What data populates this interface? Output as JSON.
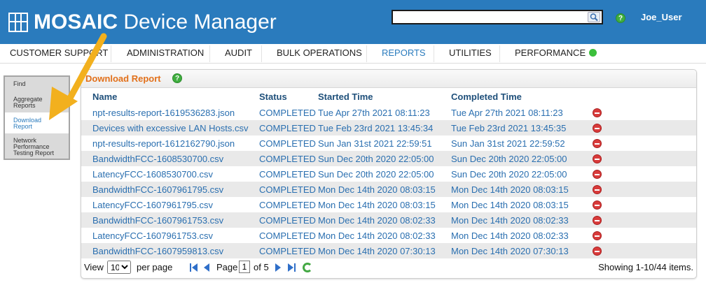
{
  "header": {
    "title_brand": "MOSAIC",
    "title_rest": " Device Manager",
    "search_placeholder": "",
    "help_glyph": "?",
    "user_name": "Joe_User",
    "icons": {
      "logo": "grid-logo-icon",
      "search": "magnifier-icon",
      "help": "help-icon"
    }
  },
  "nav": {
    "items": [
      {
        "label": "CUSTOMER SUPPORT",
        "active": false
      },
      {
        "label": "ADMINISTRATION",
        "active": false
      },
      {
        "label": "AUDIT",
        "active": false
      },
      {
        "label": "BULK OPERATIONS",
        "active": false
      },
      {
        "label": "REPORTS",
        "active": true
      },
      {
        "label": "UTILITIES",
        "active": false
      },
      {
        "label": "PERFORMANCE",
        "active": false
      }
    ],
    "performance_status_color": "#3bbf3b"
  },
  "sidebar": {
    "items": [
      {
        "label": "Find"
      },
      {
        "label": "Aggregate\nReports"
      },
      {
        "label": "Download\nReport",
        "selected": true
      },
      {
        "label": "Network\nPerformance\nTesting Report"
      }
    ]
  },
  "panel": {
    "title": "Download Report",
    "help_glyph": "?",
    "columns": [
      "Name",
      "Status",
      "Started Time",
      "Completed Time"
    ],
    "rows": [
      {
        "name": "npt-results-report-1619536283.json",
        "status": "COMPLETED",
        "started": "Tue Apr 27th 2021 08:11:23",
        "completed": "Tue Apr 27th 2021 08:11:23"
      },
      {
        "name": "Devices with excessive LAN Hosts.csv",
        "status": "COMPLETED",
        "started": "Tue Feb 23rd 2021 13:45:34",
        "completed": "Tue Feb 23rd 2021 13:45:35"
      },
      {
        "name": "npt-results-report-1612162790.json",
        "status": "COMPLETED",
        "started": "Sun Jan 31st 2021 22:59:51",
        "completed": "Sun Jan 31st 2021 22:59:52"
      },
      {
        "name": "BandwidthFCC-1608530700.csv",
        "status": "COMPLETED",
        "started": "Sun Dec 20th 2020 22:05:00",
        "completed": "Sun Dec 20th 2020 22:05:00"
      },
      {
        "name": "LatencyFCC-1608530700.csv",
        "status": "COMPLETED",
        "started": "Sun Dec 20th 2020 22:05:00",
        "completed": "Sun Dec 20th 2020 22:05:00"
      },
      {
        "name": "BandwidthFCC-1607961795.csv",
        "status": "COMPLETED",
        "started": "Mon Dec 14th 2020 08:03:15",
        "completed": "Mon Dec 14th 2020 08:03:15"
      },
      {
        "name": "LatencyFCC-1607961795.csv",
        "status": "COMPLETED",
        "started": "Mon Dec 14th 2020 08:03:15",
        "completed": "Mon Dec 14th 2020 08:03:15"
      },
      {
        "name": "BandwidthFCC-1607961753.csv",
        "status": "COMPLETED",
        "started": "Mon Dec 14th 2020 08:02:33",
        "completed": "Mon Dec 14th 2020 08:02:33"
      },
      {
        "name": "LatencyFCC-1607961753.csv",
        "status": "COMPLETED",
        "started": "Mon Dec 14th 2020 08:02:33",
        "completed": "Mon Dec 14th 2020 08:02:33"
      },
      {
        "name": "BandwidthFCC-1607959813.csv",
        "status": "COMPLETED",
        "started": "Mon Dec 14th 2020 07:30:13",
        "completed": "Mon Dec 14th 2020 07:30:13"
      }
    ],
    "delete_icon": "delete-icon"
  },
  "pager": {
    "view_label": "View",
    "per_page_value": "10",
    "per_page_label": "per page",
    "page_label": "Page",
    "page_value": "1",
    "of_label": "of 5",
    "showing": "Showing 1-10/44 items.",
    "icons": [
      "first-page-icon",
      "prev-page-icon",
      "next-page-icon",
      "last-page-icon",
      "refresh-icon"
    ]
  },
  "colors": {
    "header_bg": "#2a7bbd",
    "title_orange": "#e2701a",
    "link_blue": "#2a6fb0",
    "row_alt": "#e9e9e9",
    "arrow": "#f2b01e"
  }
}
